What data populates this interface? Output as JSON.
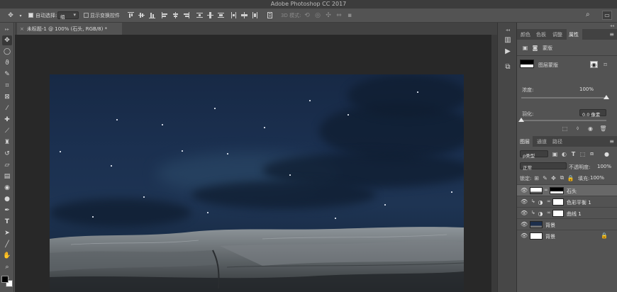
{
  "app": {
    "title": "Adobe Photoshop CC 2017"
  },
  "options_bar": {
    "auto_select_label": "自动选择:",
    "auto_select_value": "组",
    "transform_controls_label": "显示变换控件",
    "mode_3d_label": "3D 模式:"
  },
  "document": {
    "tab_title": "未标题-1 @ 100% (石头, RGB/8) *",
    "close_glyph": "×"
  },
  "properties_panel": {
    "tabs": [
      "颜色",
      "色板",
      "调整",
      "属性"
    ],
    "active_tab": "属性",
    "mask_header": "蒙版",
    "layer_mask_label": "图层蒙版",
    "density_label": "浓度:",
    "density_value": "100%",
    "feather_label": "羽化:",
    "feather_value": "0.0 像素",
    "density_level": 1.0,
    "feather_level": 0.0
  },
  "layers_panel": {
    "tabs": [
      "图层",
      "通道",
      "路径"
    ],
    "active_tab": "图层",
    "filter_label": "ρ类型",
    "blend_mode": "正常",
    "opacity_label": "不透明度:",
    "opacity_value": "100%",
    "lock_label": "锁定:",
    "fill_label": "填充:",
    "fill_value": "100%",
    "layers": [
      {
        "name": "石头",
        "selected": true
      },
      {
        "name": "色彩平衡 1",
        "selected": false
      },
      {
        "name": "曲线 1",
        "selected": false
      },
      {
        "name": "背景",
        "selected": false
      },
      {
        "name": "背景",
        "selected": false
      }
    ]
  },
  "colors": {
    "accent": "#2e6fd8",
    "canvas_sky": "#1b3050",
    "selected_layer": "#686868"
  }
}
